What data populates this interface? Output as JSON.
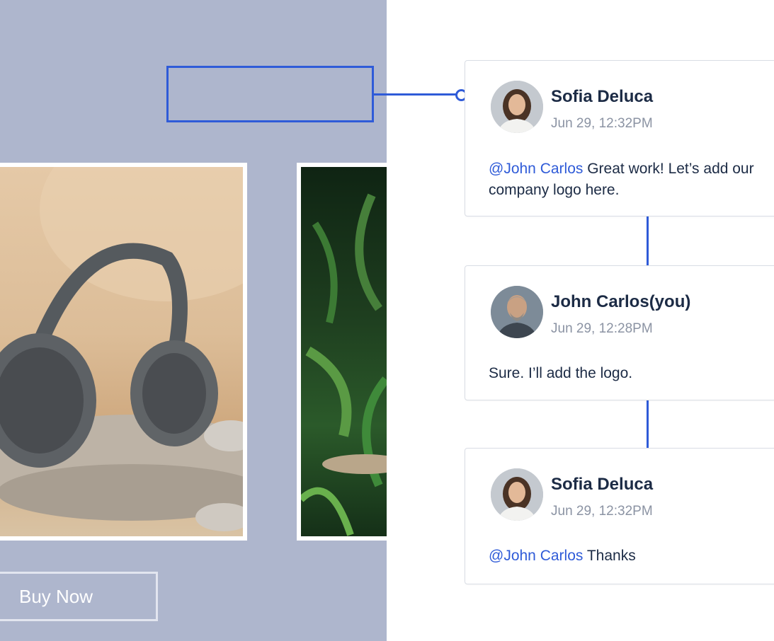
{
  "canvas": {
    "buy_button_label": "Buy Now"
  },
  "comments": [
    {
      "author": "Sofia Deluca",
      "timestamp": "Jun 29, 12:32PM",
      "mention": "@John Carlos",
      "text": " Great work! Let’s add our company logo here."
    },
    {
      "author": "John Carlos(you)",
      "timestamp": "Jun 29, 12:28PM",
      "mention": "",
      "text": "Sure. I’ll add the logo."
    },
    {
      "author": "Sofia Deluca",
      "timestamp": "Jun 29, 12:32PM",
      "mention": "@John Carlos",
      "text": " Thanks"
    }
  ],
  "colors": {
    "accent": "#2f5bd8",
    "canvas_bg": "#aeb6cd",
    "text_dark": "#1c2b45",
    "text_muted": "#8b93a3"
  }
}
